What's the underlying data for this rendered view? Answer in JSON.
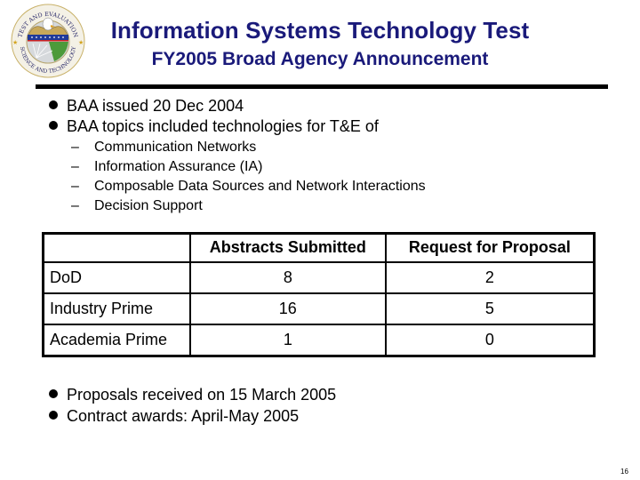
{
  "header": {
    "title": "Information Systems Technology Test",
    "subtitle": "FY2005 Broad Agency Announcement",
    "logo": {
      "icon": "test-and-evaluation-seal-icon",
      "top_text": "TEST AND EVALUATION",
      "bottom_text": "SCIENCE AND TECHNOLOGY"
    },
    "title_color": "#1a1a7a"
  },
  "bullets_top": [
    {
      "text": "BAA issued 20 Dec 2004"
    },
    {
      "text": "BAA topics included technologies for T&E of"
    }
  ],
  "sub_bullets": [
    {
      "marker": "–",
      "text": "Communication Networks"
    },
    {
      "marker": "–",
      "text": "Information Assurance (IA)"
    },
    {
      "marker": "–",
      "text": "Composable Data Sources and Network Interactions"
    },
    {
      "marker": "–",
      "text": "Decision Support"
    }
  ],
  "table": {
    "columns": [
      "",
      "Abstracts Submitted",
      "Request for Proposal"
    ],
    "rows": [
      {
        "label": "DoD",
        "abstracts": "8",
        "rfp": "2"
      },
      {
        "label": "Industry Prime",
        "abstracts": "16",
        "rfp": "5"
      },
      {
        "label": "Academia Prime",
        "abstracts": "1",
        "rfp": "0"
      }
    ]
  },
  "bullets_bottom": [
    {
      "text": "Proposals received on 15 March 2005"
    },
    {
      "text": "Contract awards: April-May 2005"
    }
  ],
  "page_number": "16"
}
